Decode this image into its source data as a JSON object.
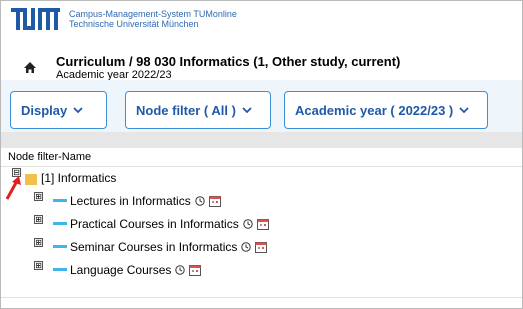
{
  "header": {
    "system_name_line1": "Campus-Management-System TUMonline",
    "system_name_line2": "Technische Universität München",
    "breadcrumb": "Curriculum / 98 030 Informatics (1, Other study, current)",
    "academic_year_subtitle": "Academic year 2022/23"
  },
  "toolbar": {
    "display_label": "Display",
    "node_filter_label": "Node filter ( All )",
    "academic_year_label": "Academic year ( 2022/23 )"
  },
  "tree": {
    "column_header": "Node filter-Name",
    "root": {
      "label": "[1] Informatics",
      "toggle": "⊟"
    },
    "children": [
      {
        "label": "Lectures in Informatics",
        "toggle": "⊞"
      },
      {
        "label": "Practical Courses in Informatics",
        "toggle": "⊞"
      },
      {
        "label": "Seminar Courses in Informatics",
        "toggle": "⊞"
      },
      {
        "label": "Language Courses",
        "toggle": "⊞"
      }
    ]
  },
  "colors": {
    "accent": "#1f5aa8",
    "toolbar_bg": "#eef5fb",
    "folder": "#f2bf4a",
    "node_bar": "#3fb5e9",
    "arrow": "#e02020"
  },
  "icons": [
    "tum-logo",
    "home-icon",
    "chevron-down-icon",
    "folder-icon",
    "clock-icon",
    "calendar-icon",
    "red-arrow-annotation"
  ]
}
